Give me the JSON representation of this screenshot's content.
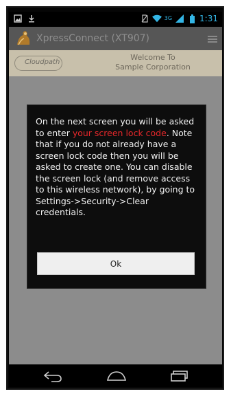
{
  "status_bar": {
    "time": "1:31",
    "network_type": "3G",
    "icons": [
      "image-icon",
      "download-icon",
      "no-sim-icon",
      "wifi-icon",
      "signal-icon",
      "battery-icon"
    ]
  },
  "action_bar": {
    "title": "XpressConnect (XT907)",
    "icons": [
      "app-logo-icon",
      "menu-icon"
    ]
  },
  "welcome_bar": {
    "logo_text": "Cloudpath",
    "line1": "Welcome To",
    "line2": "Sample Corporation"
  },
  "dialog": {
    "message_before": "On the next screen you will be asked to enter ",
    "message_highlight": "your screen lock code",
    "message_after": ". Note that if you do not already have a screen lock code then you will be asked to create one. You can disable the screen lock (and remove access to this wireless network), by going to Settings->Security->Clear credentials.",
    "ok_label": "Ok"
  },
  "nav_bar": {
    "icons": [
      "back-icon",
      "home-icon",
      "recent-apps-icon"
    ]
  },
  "colors": {
    "status_accent": "#33b5e5",
    "highlight_red": "#e8282b",
    "dialog_bg": "#0d0d0d",
    "action_bar_bg": "#565656",
    "welcome_bg": "#c8c0ab"
  }
}
